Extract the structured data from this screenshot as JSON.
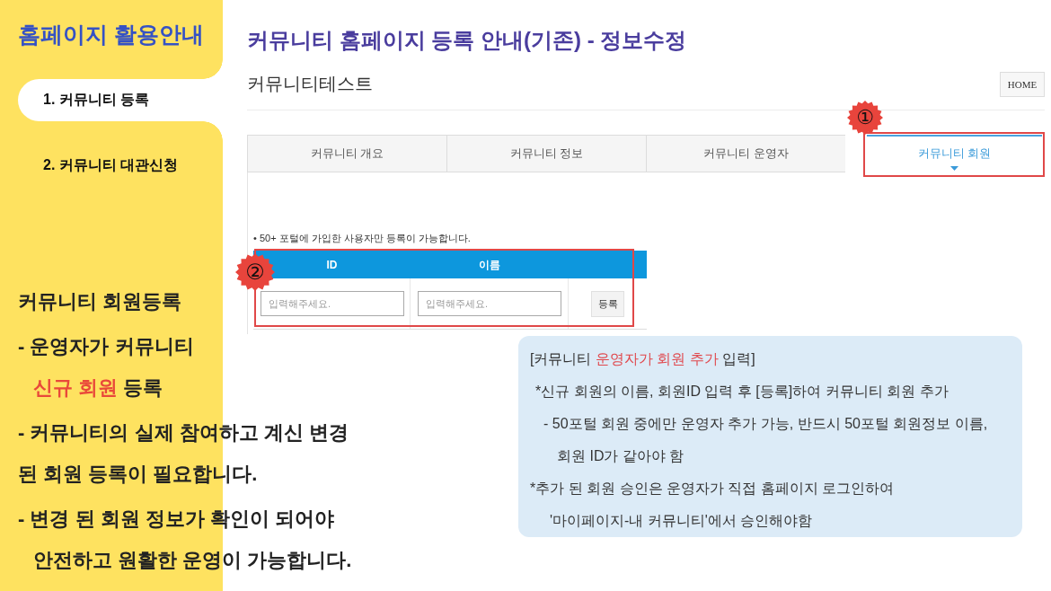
{
  "sidebar": {
    "title": "홈페이지 활용안내",
    "items": [
      {
        "label": "1. 커뮤니티 등록",
        "selected": true
      },
      {
        "label": "2. 커뮤니티 대관신청",
        "selected": false
      }
    ],
    "description": {
      "heading": "커뮤니티 회원등록",
      "bullets": [
        {
          "lines": [
            {
              "indented": false,
              "parts": [
                {
                  "text": "- 운영자가 커뮤니티",
                  "emphasis": false
                }
              ]
            },
            {
              "indented": true,
              "parts": [
                {
                  "text": "신규 회원",
                  "emphasis": true
                },
                {
                  "text": "등록",
                  "emphasis": false
                }
              ]
            }
          ]
        },
        {
          "lines": [
            {
              "indented": false,
              "parts": [
                {
                  "text": "- 커뮤니티의 실제 참여하고 계신 변경",
                  "emphasis": false
                }
              ]
            },
            {
              "indented": false,
              "parts": [
                {
                  "text": "된 회원 등록이 필요합니다.",
                  "emphasis": false
                }
              ]
            }
          ]
        },
        {
          "lines": [
            {
              "indented": false,
              "parts": [
                {
                  "text": "- 변경 된 회원 정보가 확인이 되어야",
                  "emphasis": false
                }
              ]
            },
            {
              "indented": true,
              "parts": [
                {
                  "text": "안전하고 원활한 운영이 가능합니다.",
                  "emphasis": false
                }
              ]
            }
          ]
        }
      ]
    }
  },
  "page": {
    "title": "커뮤니티 홈페이지 등록 안내(기존) - 정보수정",
    "community_name": "커뮤니티테스트",
    "home_button": "HOME",
    "tabs": [
      {
        "label": "커뮤니티 개요",
        "selected": false
      },
      {
        "label": "커뮤니티 정보",
        "selected": false
      },
      {
        "label": "커뮤니티 운영자",
        "selected": false
      },
      {
        "label": "커뮤니티 회원",
        "selected": true,
        "marker": "①"
      }
    ],
    "notice": "• 50+ 포털에 가입한 사용자만 등록이 가능합니다.",
    "member_table": {
      "columns": [
        "ID",
        "이름"
      ],
      "fields": [
        {
          "placeholder": "입력해주세요."
        },
        {
          "placeholder": "입력해주세요."
        }
      ],
      "button": "등록",
      "marker": "②"
    }
  },
  "info_box": {
    "heading": [
      {
        "text": "[커뮤니티",
        "emphasis": false
      },
      {
        "text": "운영자가 회원 추가",
        "emphasis": true
      },
      {
        "text": "입력]",
        "emphasis": false
      }
    ],
    "notes": [
      {
        "lines": [
          "*신규 회원의 이름, 회원ID 입력 후 [등록]하여 커뮤니티 회원 추가"
        ],
        "children": [
          {
            "lines": [
              "- 50포털 회원 중에만 운영자 추가 가능, 반드시 50포털 회원정보 이름,",
              "회원 ID가 같아야 함"
            ]
          }
        ]
      },
      {
        "lines": [
          "*추가 된 회원 승인은 운영자가 직접 홈페이지 로그인하여",
          "'마이페이지-내 커뮤니티'에서 승인해야함"
        ]
      }
    ]
  }
}
